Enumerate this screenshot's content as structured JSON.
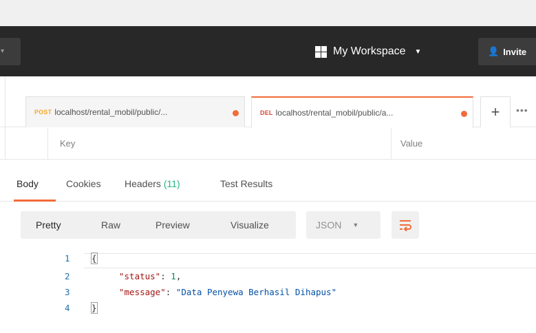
{
  "header": {
    "workspace_label": "My Workspace",
    "invite_label": "Invite",
    "icons": {
      "workspace": "grid-icon",
      "workspace_caret": "caret-down-icon",
      "invite": "person-add-icon",
      "left": "chevron-down-icon"
    }
  },
  "tabs": [
    {
      "method": "POST",
      "url": "localhost/rental_mobil/public/...",
      "unsaved": true,
      "active": false
    },
    {
      "method": "DEL",
      "url": "localhost/rental_mobil/public/a...",
      "unsaved": true,
      "active": true
    }
  ],
  "tab_actions": {
    "new_tab": "+",
    "more": "•••"
  },
  "params_table": {
    "key_header": "Key",
    "value_header": "Value"
  },
  "response_tabs": {
    "body": "Body",
    "cookies": "Cookies",
    "headers": "Headers",
    "headers_count": "(11)",
    "test_results": "Test Results"
  },
  "response_toolbar": {
    "modes": [
      "Pretty",
      "Raw",
      "Preview",
      "Visualize"
    ],
    "format": "JSON",
    "wrap_icon": "wrap-lines-icon"
  },
  "code": {
    "lines": [
      {
        "n": "1",
        "text": "{"
      },
      {
        "n": "2",
        "key": "\"status\"",
        "value": "1"
      },
      {
        "n": "3",
        "key": "\"message\"",
        "value": "\"Data Penyewa Berhasil Dihapus\""
      },
      {
        "n": "4",
        "text": "}"
      }
    ]
  },
  "colors": {
    "accent": "#f26b3a",
    "header_bg": "#282828",
    "post_method": "#f8a828",
    "delete_method": "#d54a3a",
    "headers_count": "#26b47f"
  }
}
